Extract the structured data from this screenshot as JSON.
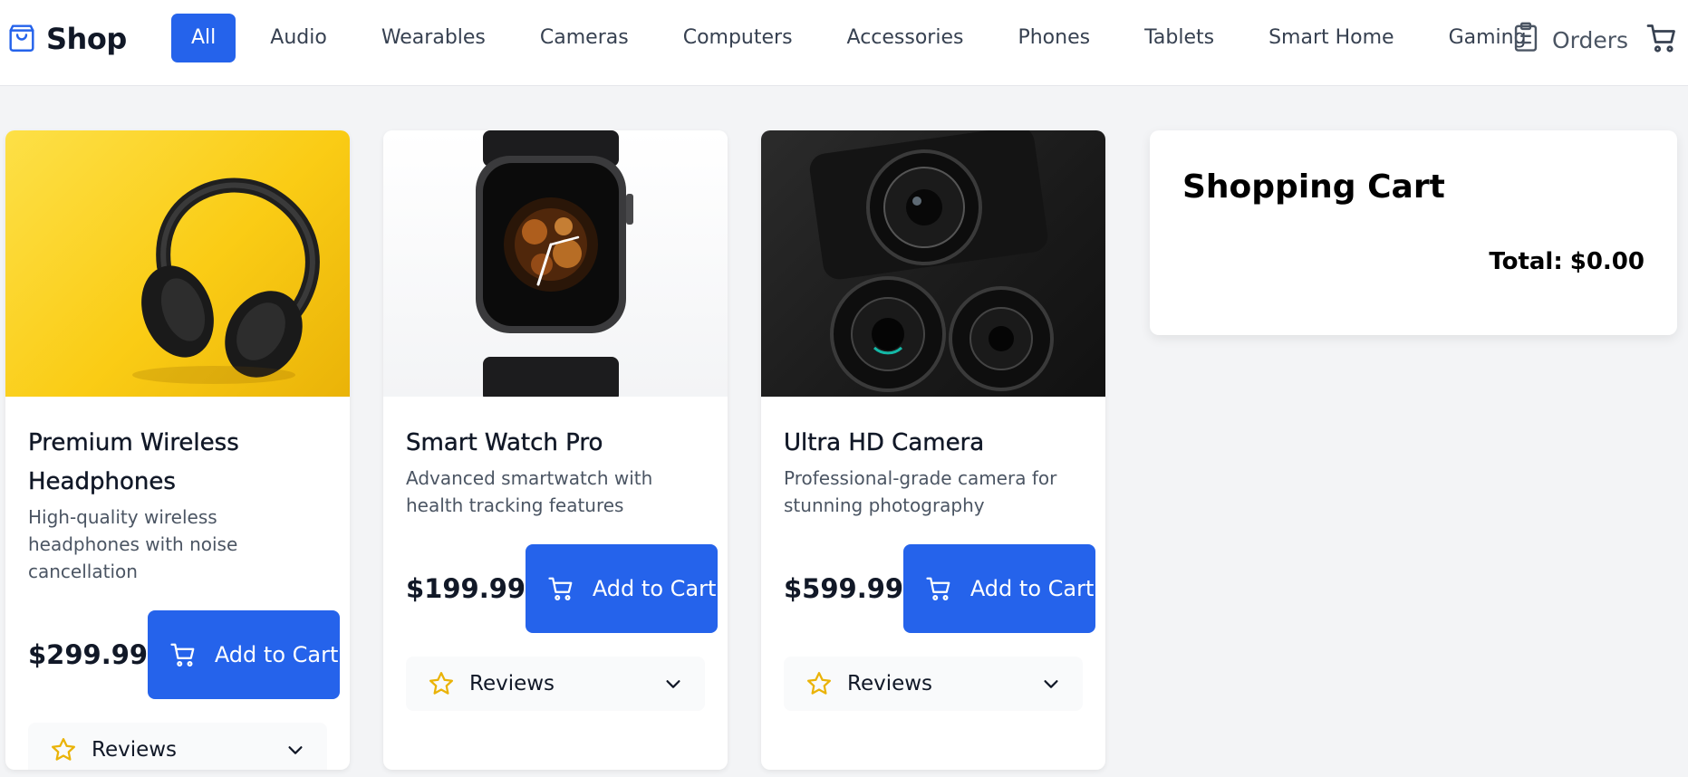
{
  "header": {
    "brand": "Shop",
    "categories": [
      {
        "label": "All",
        "active": true
      },
      {
        "label": "Audio"
      },
      {
        "label": "Wearables"
      },
      {
        "label": "Cameras"
      },
      {
        "label": "Computers"
      },
      {
        "label": "Accessories"
      },
      {
        "label": "Phones"
      },
      {
        "label": "Tablets"
      },
      {
        "label": "Smart Home"
      },
      {
        "label": "Gaming"
      }
    ],
    "orders_label": "Orders"
  },
  "products": [
    {
      "title": "Premium Wireless Headphones",
      "description": "High-quality wireless headphones with noise cancellation",
      "price": "$299.99",
      "add_label": "Add to Cart",
      "reviews_label": "Reviews"
    },
    {
      "title": "Smart Watch Pro",
      "description": "Advanced smartwatch with health tracking features",
      "price": "$199.99",
      "add_label": "Add to Cart",
      "reviews_label": "Reviews"
    },
    {
      "title": "Ultra HD Camera",
      "description": "Professional-grade camera for stunning photography",
      "price": "$599.99",
      "add_label": "Add to Cart",
      "reviews_label": "Reviews"
    }
  ],
  "cart": {
    "title": "Shopping Cart",
    "total_label": "Total:",
    "total_value": "$0.00"
  },
  "colors": {
    "accent": "#2563eb",
    "star": "#eab308",
    "background": "#f3f4f6"
  }
}
